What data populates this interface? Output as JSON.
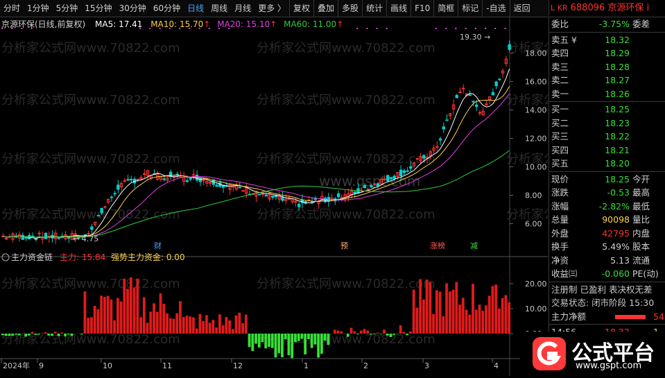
{
  "toolbar": {
    "periods": [
      "分时",
      "1分钟",
      "5分钟",
      "15分钟",
      "30分钟",
      "60分钟",
      "日线",
      "周线",
      "月线",
      "更多 〉"
    ],
    "active_period": "日线",
    "tools": [
      "复权",
      "叠加",
      "多股",
      "统计",
      "画线",
      "F10",
      "简框",
      "标记",
      "-自选",
      "返回"
    ]
  },
  "chart": {
    "stock_label": "京源环保(日线,前复权)",
    "ma5": "MA5: 17.41",
    "ma10": "MA10: 15.70",
    "ma20": "MA20: 15.10",
    "ma60": "MA60: 11.00",
    "high_label": "19.30",
    "low_label": "4.75",
    "watermarks": [
      "分析家公式网www.70822.com",
      "www.gspt.com"
    ],
    "event_tags": [
      "财",
      "预",
      "涨榜",
      "减"
    ],
    "x_labels": [
      "2024年",
      "9",
      "10",
      "11",
      "12",
      "1",
      "2",
      "3",
      "4"
    ],
    "y_labels": [
      "18.00",
      "16.00",
      "14.00",
      "12.00",
      "10.00",
      "8.00",
      "6.00"
    ]
  },
  "indicator": {
    "name": "主力资金链",
    "main_force": "主力: 15.84",
    "strong_force": "强势主力资金: 0.00",
    "y_labels": [
      "20.00",
      "10.00",
      "0.00"
    ]
  },
  "quote": {
    "market_tag": "L KR",
    "code": "688096",
    "name": "京源环保",
    "info_icon": "i",
    "weibi_label": "委比",
    "weibi_value": "-3.75%",
    "weicha_label": "委差",
    "asks": [
      {
        "label": "卖五 ¥",
        "price": "18.32"
      },
      {
        "label": "卖四",
        "price": "18.29"
      },
      {
        "label": "卖三",
        "price": "18.28"
      },
      {
        "label": "卖二",
        "price": "18.27"
      },
      {
        "label": "卖一",
        "price": "18.26"
      }
    ],
    "bids": [
      {
        "label": "买一",
        "price": "18.25"
      },
      {
        "label": "买二",
        "price": "18.23"
      },
      {
        "label": "买三",
        "price": "18.22"
      },
      {
        "label": "买四",
        "price": "18.21"
      },
      {
        "label": "买五",
        "price": "18.20"
      }
    ],
    "stats": [
      {
        "label": "现价",
        "value": "18.25",
        "right": "今开"
      },
      {
        "label": "涨跌",
        "value": "-0.53",
        "right": "最高"
      },
      {
        "label": "涨幅",
        "value": "-2.82%",
        "right": "最低"
      },
      {
        "label": "总量",
        "value": "90098",
        "right": "量比"
      },
      {
        "label": "外盘",
        "value": "42795",
        "right": "内盘"
      },
      {
        "label": "换手",
        "value": "5.49%",
        "right": "股本"
      },
      {
        "label": "净资",
        "value": "5.13",
        "right": "流通"
      },
      {
        "label": "收益㈢",
        "value": "-0.060",
        "right": "PE(动)"
      }
    ],
    "tags_line": "注册制 已盈利 表决权无差",
    "trade_status": "交易状态: 闭市阶段 15:30",
    "net_label": "主力净额",
    "net_value": "54",
    "tick_time": "14:56",
    "tick_price": "18.32",
    "tick_vol": "1"
  },
  "logo": {
    "text": "公式平台",
    "url": "www.gspt.com"
  },
  "colors": {
    "up": "#ff3232",
    "down": "#00d0d0",
    "ma5": "#ffffff",
    "ma10": "#ffd24a",
    "ma20": "#e040e0",
    "ma60": "#2ecc40",
    "flow_up": "#e01b1b",
    "flow_down": "#36e036",
    "active": "#4aa3ff"
  }
}
